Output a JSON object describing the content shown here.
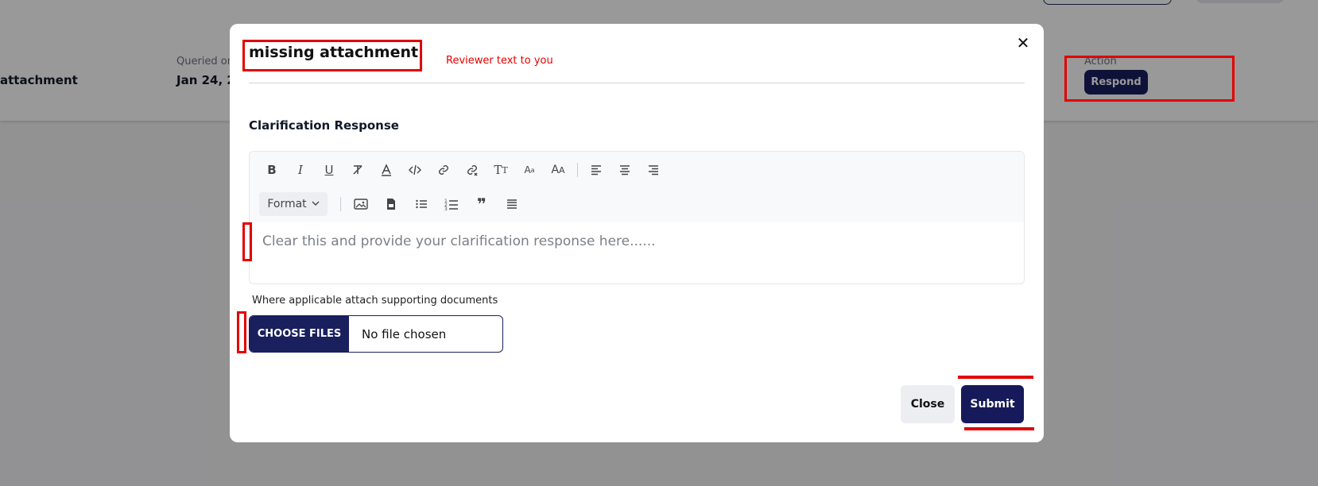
{
  "background": {
    "row_title": "attachment",
    "queried_label": "Queried on",
    "queried_value": "Jan 24, 2",
    "action_label": "Action",
    "respond_label": "Respond"
  },
  "modal": {
    "title": "missing attachment",
    "reviewer_note": "Reviewer text to you",
    "close_icon": "✕",
    "section_label": "Clarification Response",
    "toolbar": {
      "row1_icons": [
        "bold-icon",
        "italic-icon",
        "underline-icon",
        "clear-format-icon",
        "font-color-icon",
        "code-icon",
        "link-icon",
        "unlink-icon",
        "text-size-icon",
        "font-small-icon",
        "font-size-icon",
        "align-left-icon",
        "align-center-icon",
        "align-right-icon"
      ],
      "format_label": "Format",
      "row2_icons": [
        "image-icon",
        "document-icon",
        "bullet-list-icon",
        "numbered-list-icon",
        "blockquote-icon",
        "horizontal-rule-icon"
      ]
    },
    "editor_placeholder": "Clear this and provide your clarification response here......",
    "attach_label": "Where applicable attach supporting documents",
    "choose_files_label": "CHOOSE FILES",
    "file_status": "No file chosen",
    "close_label": "Close",
    "submit_label": "Submit"
  },
  "colors": {
    "primary": "#1a1f5e",
    "annotation": "#e30000",
    "overlay": "rgba(0,0,0,0.40)"
  }
}
